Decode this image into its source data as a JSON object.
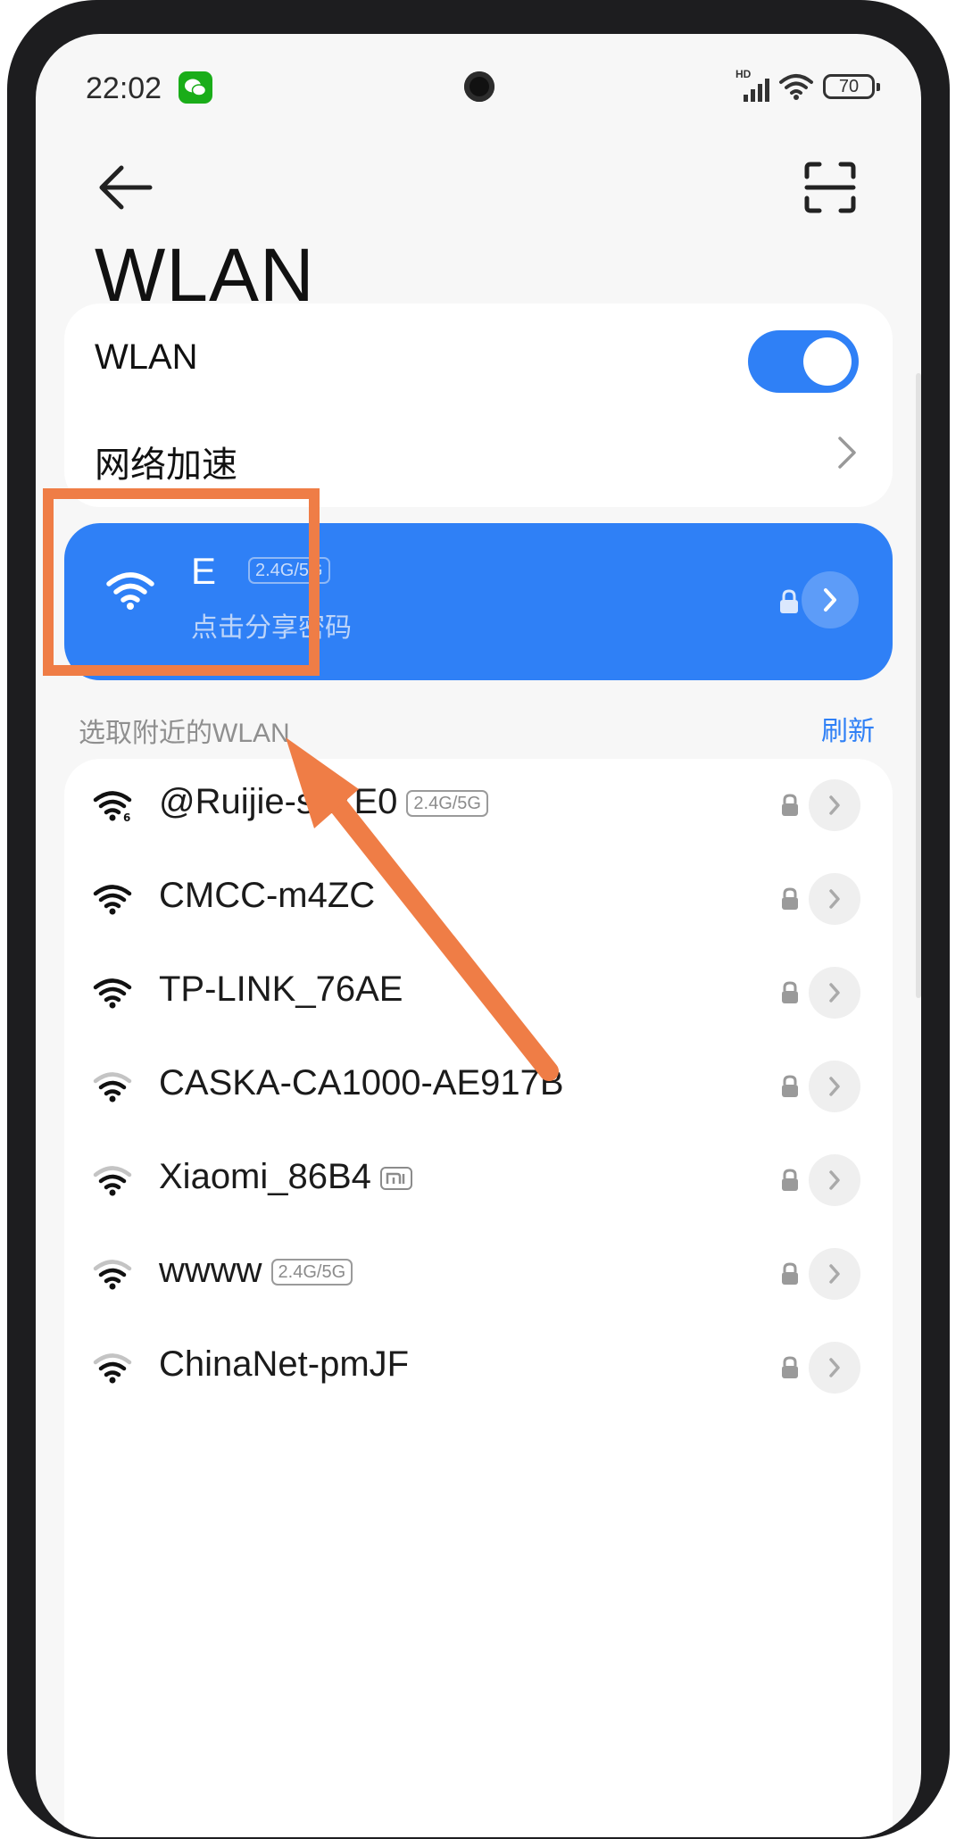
{
  "status_bar": {
    "time": "22:02",
    "signal_label": "HD",
    "battery": "70"
  },
  "header": {
    "title": "WLAN"
  },
  "settings": {
    "wlan_label": "WLAN",
    "wlan_enabled": true,
    "network_acceleration_label": "网络加速"
  },
  "connected_network": {
    "name": "E",
    "band": "2.4G/5G",
    "subtitle": "点击分享密码"
  },
  "nearby": {
    "section_title": "选取附近的WLAN",
    "refresh_label": "刷新",
    "networks": [
      {
        "name": "@Ruijie-s27E0",
        "band": "2.4G/5G",
        "signal": "wifi-6-icon",
        "secured": true
      },
      {
        "name": "CMCC-m4ZC",
        "band": "",
        "signal": "wifi-full-icon",
        "secured": true
      },
      {
        "name": "TP-LINK_76AE",
        "band": "",
        "signal": "wifi-full-icon",
        "secured": true
      },
      {
        "name": "CASKA-CA1000-AE917B",
        "band": "",
        "signal": "wifi-weak-icon",
        "secured": true
      },
      {
        "name": "Xiaomi_86B4",
        "band": "mi",
        "signal": "wifi-weak-icon",
        "secured": true
      },
      {
        "name": "wwww",
        "band": "2.4G/5G",
        "signal": "wifi-weak-icon",
        "secured": true
      },
      {
        "name": "ChinaNet-pmJF",
        "band": "",
        "signal": "wifi-weak-icon",
        "secured": true
      }
    ]
  },
  "colors": {
    "accent": "#2f80f6",
    "annotation": "#ef7d46"
  }
}
